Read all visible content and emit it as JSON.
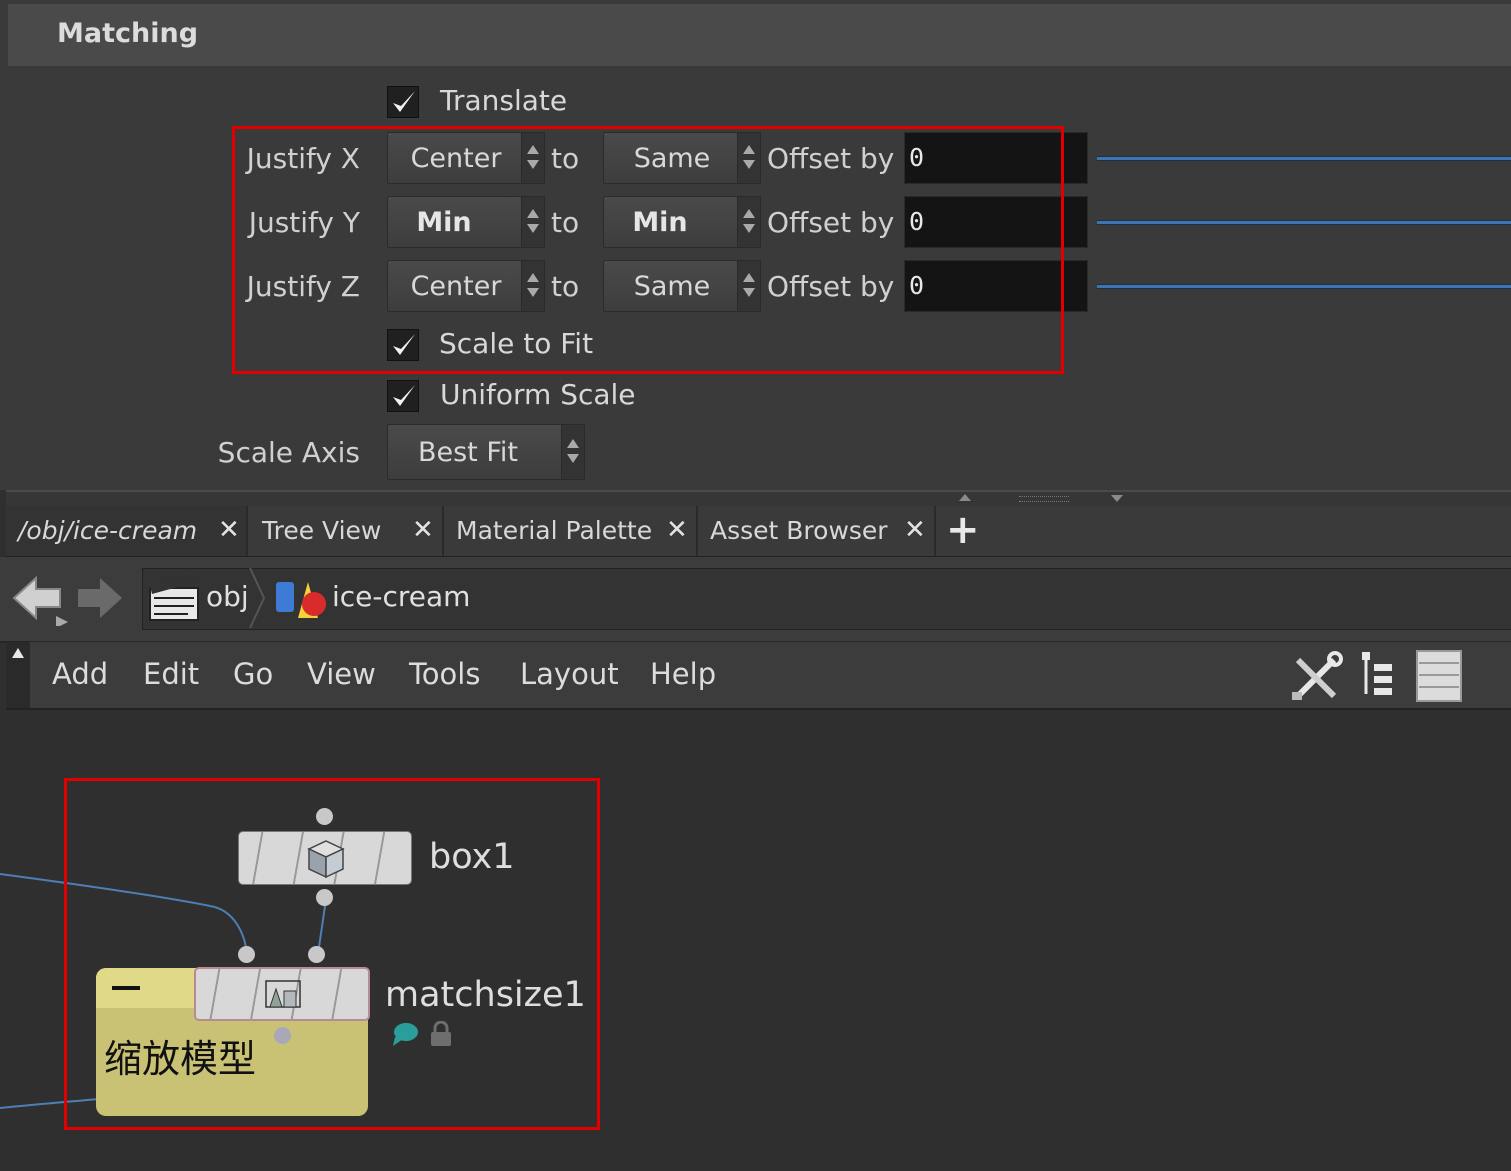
{
  "section": {
    "title": "Matching"
  },
  "translate": {
    "label": "Translate",
    "checked": true
  },
  "justify_rows": [
    {
      "label": "Justify X",
      "from": "Center",
      "to_text": "to",
      "to": "Same",
      "offset_label": "Offset by",
      "offset": "0"
    },
    {
      "label": "Justify Y",
      "from": "Min",
      "to_text": "to",
      "to": "Min",
      "offset_label": "Offset by",
      "offset": "0"
    },
    {
      "label": "Justify Z",
      "from": "Center",
      "to_text": "to",
      "to": "Same",
      "offset_label": "Offset by",
      "offset": "0"
    }
  ],
  "scale_to_fit": {
    "label": "Scale to Fit",
    "checked": true
  },
  "uniform_scale": {
    "label": "Uniform Scale",
    "checked": true
  },
  "scale_axis": {
    "label": "Scale Axis",
    "value": "Best Fit"
  },
  "tabs": [
    {
      "label": "/obj/ice-cream",
      "close": "✕"
    },
    {
      "label": "Tree View",
      "close": "✕"
    },
    {
      "label": "Material Palette",
      "close": "✕"
    },
    {
      "label": "Asset Browser",
      "close": "✕"
    }
  ],
  "add_tab": "+",
  "path": {
    "root": "obj",
    "current": "ice-cream"
  },
  "menu": [
    "Add",
    "Edit",
    "Go",
    "View",
    "Tools",
    "Layout",
    "Help"
  ],
  "toolbar_icons": [
    "wrench-screwdriver-icon",
    "tree-list-icon",
    "list-view-icon"
  ],
  "nodes": {
    "box": {
      "name": "box1",
      "icon": "cube-icon"
    },
    "matchsize": {
      "name": "matchsize1",
      "icon": "match-size-icon"
    }
  },
  "sticky_note": {
    "text": "缩放模型",
    "color": "#c9c274"
  },
  "colors": {
    "highlight_box": "#e10000",
    "wire": "#4c7fb4",
    "slider": "#3f74b3"
  }
}
